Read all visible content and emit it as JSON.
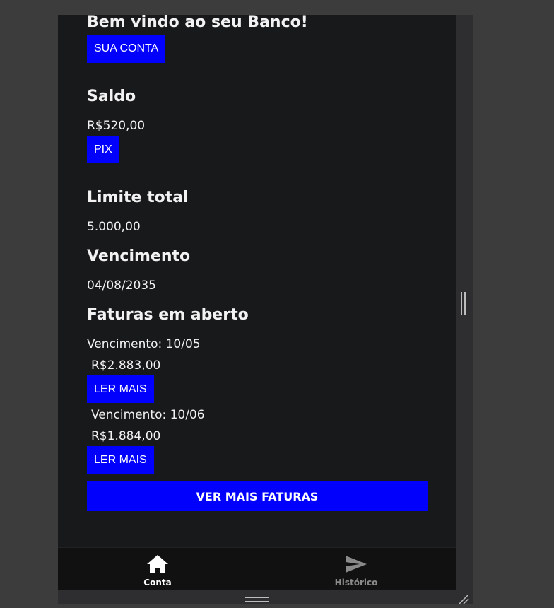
{
  "welcome": {
    "title": "Bem vindo ao seu Banco!",
    "account_button": "SUA CONTA"
  },
  "balance": {
    "heading": "Saldo",
    "value": "R$520,00",
    "pix_button": "PIX"
  },
  "limit": {
    "heading": "Limite total",
    "value": "5.000,00"
  },
  "due": {
    "heading": "Vencimento",
    "value": "04/08/2035"
  },
  "invoices": {
    "heading": "Faturas em aberto",
    "items": [
      {
        "due": "Vencimento: 10/05",
        "amount": "R$2.883,00",
        "button": "LER MAIS"
      },
      {
        "due": "Vencimento: 10/06",
        "amount": "R$1.884,00",
        "button": "LER MAIS"
      }
    ],
    "more_button": "VER MAIS FATURAS"
  },
  "nav": {
    "items": [
      {
        "label": "Conta",
        "icon": "home-icon",
        "active": true
      },
      {
        "label": "Histórico",
        "icon": "send-icon",
        "active": false
      }
    ]
  },
  "colors": {
    "accent": "#0000fc",
    "background": "#18191b",
    "nav_active": "#ffffff",
    "nav_inactive": "#8a8a8a"
  }
}
